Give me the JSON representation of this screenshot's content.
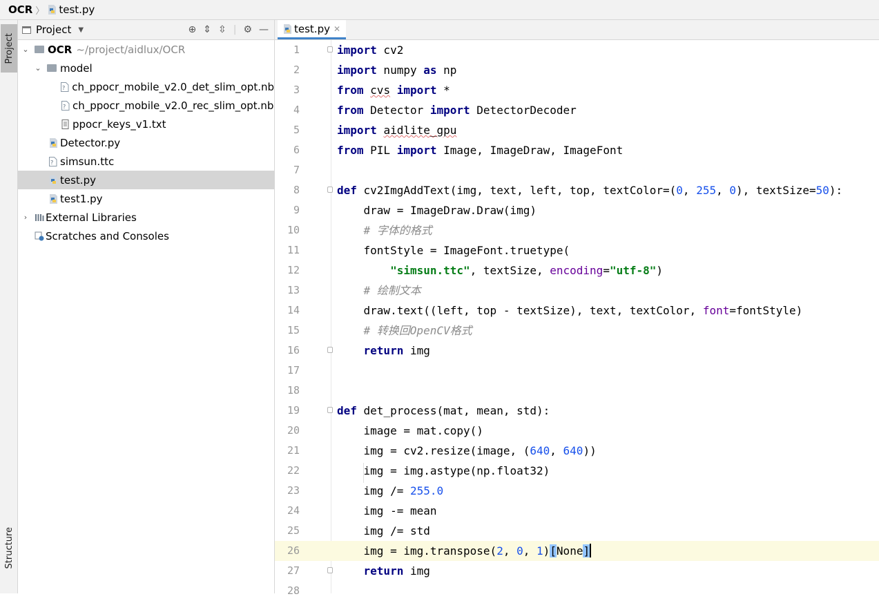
{
  "breadcrumb": {
    "root": "OCR",
    "file": "test.py"
  },
  "sidebar": {
    "project_tab": "Project",
    "structure_tab": "Structure"
  },
  "project_panel": {
    "title": "Project",
    "tree": [
      {
        "label": "OCR",
        "detail": "~/project/aidlux/OCR",
        "type": "folder",
        "depth": 0,
        "expanded": true
      },
      {
        "label": "model",
        "type": "folder",
        "depth": 1,
        "expanded": true
      },
      {
        "label": "ch_ppocr_mobile_v2.0_det_slim_opt.nb",
        "type": "file",
        "depth": 2
      },
      {
        "label": "ch_ppocr_mobile_v2.0_rec_slim_opt.nb",
        "type": "file",
        "depth": 2
      },
      {
        "label": "ppocr_keys_v1.txt",
        "type": "text",
        "depth": 2
      },
      {
        "label": "Detector.py",
        "type": "python",
        "depth": 1
      },
      {
        "label": "simsun.ttc",
        "type": "file",
        "depth": 1
      },
      {
        "label": "test.py",
        "type": "python",
        "depth": 1,
        "selected": true
      },
      {
        "label": "test1.py",
        "type": "python",
        "depth": 1
      },
      {
        "label": "External Libraries",
        "type": "library",
        "depth": 0
      },
      {
        "label": "Scratches and Consoles",
        "type": "scratch",
        "depth": 0
      }
    ]
  },
  "editor": {
    "tab_label": "test.py",
    "current_line": 26,
    "line_numbers": [
      "1",
      "2",
      "3",
      "4",
      "5",
      "6",
      "7",
      "8",
      "9",
      "10",
      "11",
      "12",
      "13",
      "14",
      "15",
      "16",
      "17",
      "18",
      "19",
      "20",
      "21",
      "22",
      "23",
      "24",
      "25",
      "26",
      "27",
      "28"
    ],
    "lines": [
      "import cv2",
      "import numpy as np",
      "from cvs import *",
      "from Detector import DetectorDecoder",
      "import aidlite_gpu",
      "from PIL import Image, ImageDraw, ImageFont",
      "",
      "def cv2ImgAddText(img, text, left, top, textColor=(0, 255, 0), textSize=50):",
      "    draw = ImageDraw.Draw(img)",
      "    # 字体的格式",
      "    fontStyle = ImageFont.truetype(",
      "        \"simsun.ttc\", textSize, encoding=\"utf-8\")",
      "    # 绘制文本",
      "    draw.text((left, top - textSize), text, textColor, font=fontStyle)",
      "    # 转换回OpenCV格式",
      "    return img",
      "",
      "",
      "def det_process(mat, mean, std):",
      "    image = mat.copy()",
      "    img = cv2.resize(image, (640, 640))",
      "    img = img.astype(np.float32)",
      "    img /= 255.0",
      "    img -= mean",
      "    img /= std",
      "    img = img.transpose(2, 0, 1)[None]",
      "    return img",
      ""
    ]
  },
  "colors": {
    "keyword": "#000080",
    "number": "#1750eb",
    "string": "#067d17",
    "comment": "#8c8c8c",
    "selection": "#d5d5d5",
    "current_line": "#fcfae0"
  }
}
